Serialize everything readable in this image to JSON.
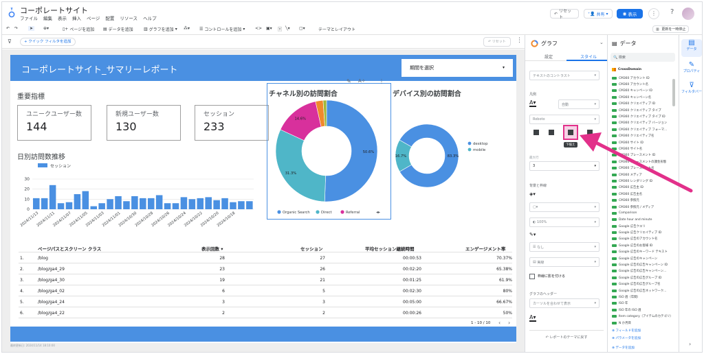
{
  "app": {
    "title": "コーポレートサイト",
    "menu": [
      "ファイル",
      "編集",
      "表示",
      "挿入",
      "ページ",
      "配置",
      "リソース",
      "ヘルプ"
    ],
    "reset_label": "リセット",
    "share_label": "共有",
    "view_label": "表示"
  },
  "toolbar": {
    "add_page": "ページを追加",
    "add_data": "データを追加",
    "add_chart": "グラフを追加",
    "add_control": "コントロールを追加",
    "theme_layout": "テーマとレイアウト",
    "pause_update": "更新を一時停止"
  },
  "filterbar": {
    "quick_filter": "+ クイック フィルタを追加",
    "reset": "リセット"
  },
  "report": {
    "title": "コーポレートサイト_サマリーレポート",
    "period_placeholder": "期間を選択",
    "kpi_section": "重要指標",
    "kpis": [
      {
        "label": "ユニークユーザー数",
        "value": "144"
      },
      {
        "label": "新規ユーザー数",
        "value": "130"
      },
      {
        "label": "セッション",
        "value": "233"
      }
    ],
    "daily_title": "日別訪問数推移",
    "channel_title": "チャネル別の訪問割合",
    "device_title": "デバイス別の訪問割合",
    "footer_text": "最終更新日: 2024/11/14 18:10:00"
  },
  "chart_data": [
    {
      "type": "bar",
      "title": "日別訪問数推移",
      "series": [
        {
          "name": "セッション",
          "values": [
            11,
            11,
            24,
            6,
            7,
            15,
            18,
            3,
            6,
            10,
            13,
            8,
            13,
            11,
            11,
            14,
            6,
            6,
            12,
            10,
            11,
            12,
            9,
            11,
            7,
            8,
            8
          ]
        }
      ],
      "x_tick_labels": [
        "2024/11/13",
        "2024/11/11",
        "2024/11/07",
        "2024/11/05",
        "2024/11/03",
        "2024/11/01",
        "2024/10/30",
        "2024/10/28",
        "2024/10/26",
        "2024/10/24",
        "2024/10/22",
        "2024/10/20",
        "2024/10/18"
      ],
      "ylim": [
        0,
        30
      ],
      "y_ticks": [
        0,
        10,
        20,
        30
      ],
      "color": "#4a90e2"
    },
    {
      "type": "pie",
      "title": "チャネル別の訪問割合",
      "slices": [
        {
          "label": "Organic Search",
          "value": 50.6,
          "color": "#4a90e2",
          "display": "50.6%"
        },
        {
          "label": "Direct",
          "value": 31.3,
          "color": "#4fb6c8",
          "display": "31.3%"
        },
        {
          "label": "Referral",
          "value": 14.6,
          "color": "#d8309c",
          "display": "14.6%"
        },
        {
          "label": "",
          "value": 2.4,
          "color": "#f0892d",
          "display": ""
        },
        {
          "label": "",
          "value": 1.1,
          "color": "#a3b83a",
          "display": ""
        }
      ],
      "legend": [
        "Organic Search",
        "Direct",
        "Referral"
      ]
    },
    {
      "type": "pie",
      "title": "デバイス別の訪問割合",
      "slices": [
        {
          "label": "desktop",
          "value": 83.3,
          "color": "#4a90e2",
          "display": "83.3%"
        },
        {
          "label": "mobile",
          "value": 16.7,
          "color": "#4fb6c8",
          "display": "16.7%"
        }
      ],
      "legend": [
        "desktop",
        "mobile"
      ]
    }
  ],
  "table": {
    "headers": [
      "ページパスとスクリーン クラス",
      "表示回数 ▾",
      "セッション",
      "平均セッション継続時間",
      "エンゲージメント率"
    ],
    "rows": [
      {
        "n": "1.",
        "path": "/blog",
        "views": "28",
        "sessions": "27",
        "duration": "00:00:53",
        "rate": "70.37%"
      },
      {
        "n": "2.",
        "path": "/blog/ga4_29",
        "views": "23",
        "sessions": "26",
        "duration": "00:02:20",
        "rate": "65.38%"
      },
      {
        "n": "3.",
        "path": "/blog/ga4_30",
        "views": "19",
        "sessions": "21",
        "duration": "00:01:25",
        "rate": "61.9%"
      },
      {
        "n": "4.",
        "path": "/blog/ga4_02",
        "views": "6",
        "sessions": "5",
        "duration": "00:02:30",
        "rate": "80%"
      },
      {
        "n": "5.",
        "path": "/blog/ga4_24",
        "views": "3",
        "sessions": "3",
        "duration": "00:05:00",
        "rate": "66.67%"
      },
      {
        "n": "6.",
        "path": "/blog/ga4_22",
        "views": "2",
        "sessions": "2",
        "duration": "00:00:26",
        "rate": "50%"
      }
    ],
    "pagination": "1 - 10 / 10"
  },
  "chart_panel": {
    "title": "グラフ",
    "tab_setup": "設定",
    "tab_style": "スタイル",
    "contrast": "テキストのコントラスト",
    "legend_label": "凡例",
    "auto": "自動",
    "font": "Roboto",
    "tooltip_bottom": "下揃え",
    "max_lines_label": "最大行",
    "max_lines_value": "3",
    "bg_border": "背景と枠線",
    "opacity": "100%",
    "border_none": "なし",
    "shadow_label": "枠線に影を付ける",
    "header_label": "グラフのヘッダー",
    "header_value": "カーソルを合わせて表示",
    "reset_theme": "レポートのテーマに戻す",
    "accent_color": "#e2308a"
  },
  "data_panel": {
    "title": "データ",
    "search": "検索",
    "source": "CrossDomain",
    "fields": [
      "CM360 アカウント ID",
      "CM360 アカウント名",
      "CM360 キャンペーン ID",
      "CM360 キャンペーン名",
      "CM360 クリエイティブ ID",
      "CM360 クリエイティブ タイプ",
      "CM360 クリエイティブ タイプ ID",
      "CM360 クリエイティブ バージョン",
      "CM360 クリエイティブ フォーマ...",
      "CM360 クリエイティブ名",
      "CM360 サイト ID",
      "CM360 サイト名",
      "CM360 プレースメント ID",
      "CM360 プレースメントの課金形態",
      "CM360 プレースメント名",
      "CM360 メディア",
      "CM360 レンダリング ID",
      "CM360 広告主 ID",
      "CM360 広告主名",
      "CM360 参照元",
      "CM360 参照元 / メディア",
      "Comparison",
      "Date hour and minute",
      "Google 広告クエリ",
      "Google 広告クリエイティブ ID",
      "Google 広告のアカウント名",
      "Google 広告のお客様 ID",
      "Google 広告のキーワード テキスト",
      "Google 広告のキャンペーン",
      "Google 広告の広告キャンペーン ID",
      "Google 広告の広告キャンペーン...",
      "Google 広告の広告グループ ID",
      "Google 広告の広告グループ名",
      "Google 広告の広告ネットワーク...",
      "ISO 週（年間）",
      "ISO 年",
      "ISO 年の ISO 週",
      "Item category（アイテムのカテゴリ）",
      "N か月目"
    ],
    "add_field": "フィールドを追加",
    "add_param": "パラメータを追加",
    "add_data": "データを追加"
  },
  "rail": {
    "data": "データ",
    "properties": "プロパティ",
    "filter": "フィルタバー"
  }
}
